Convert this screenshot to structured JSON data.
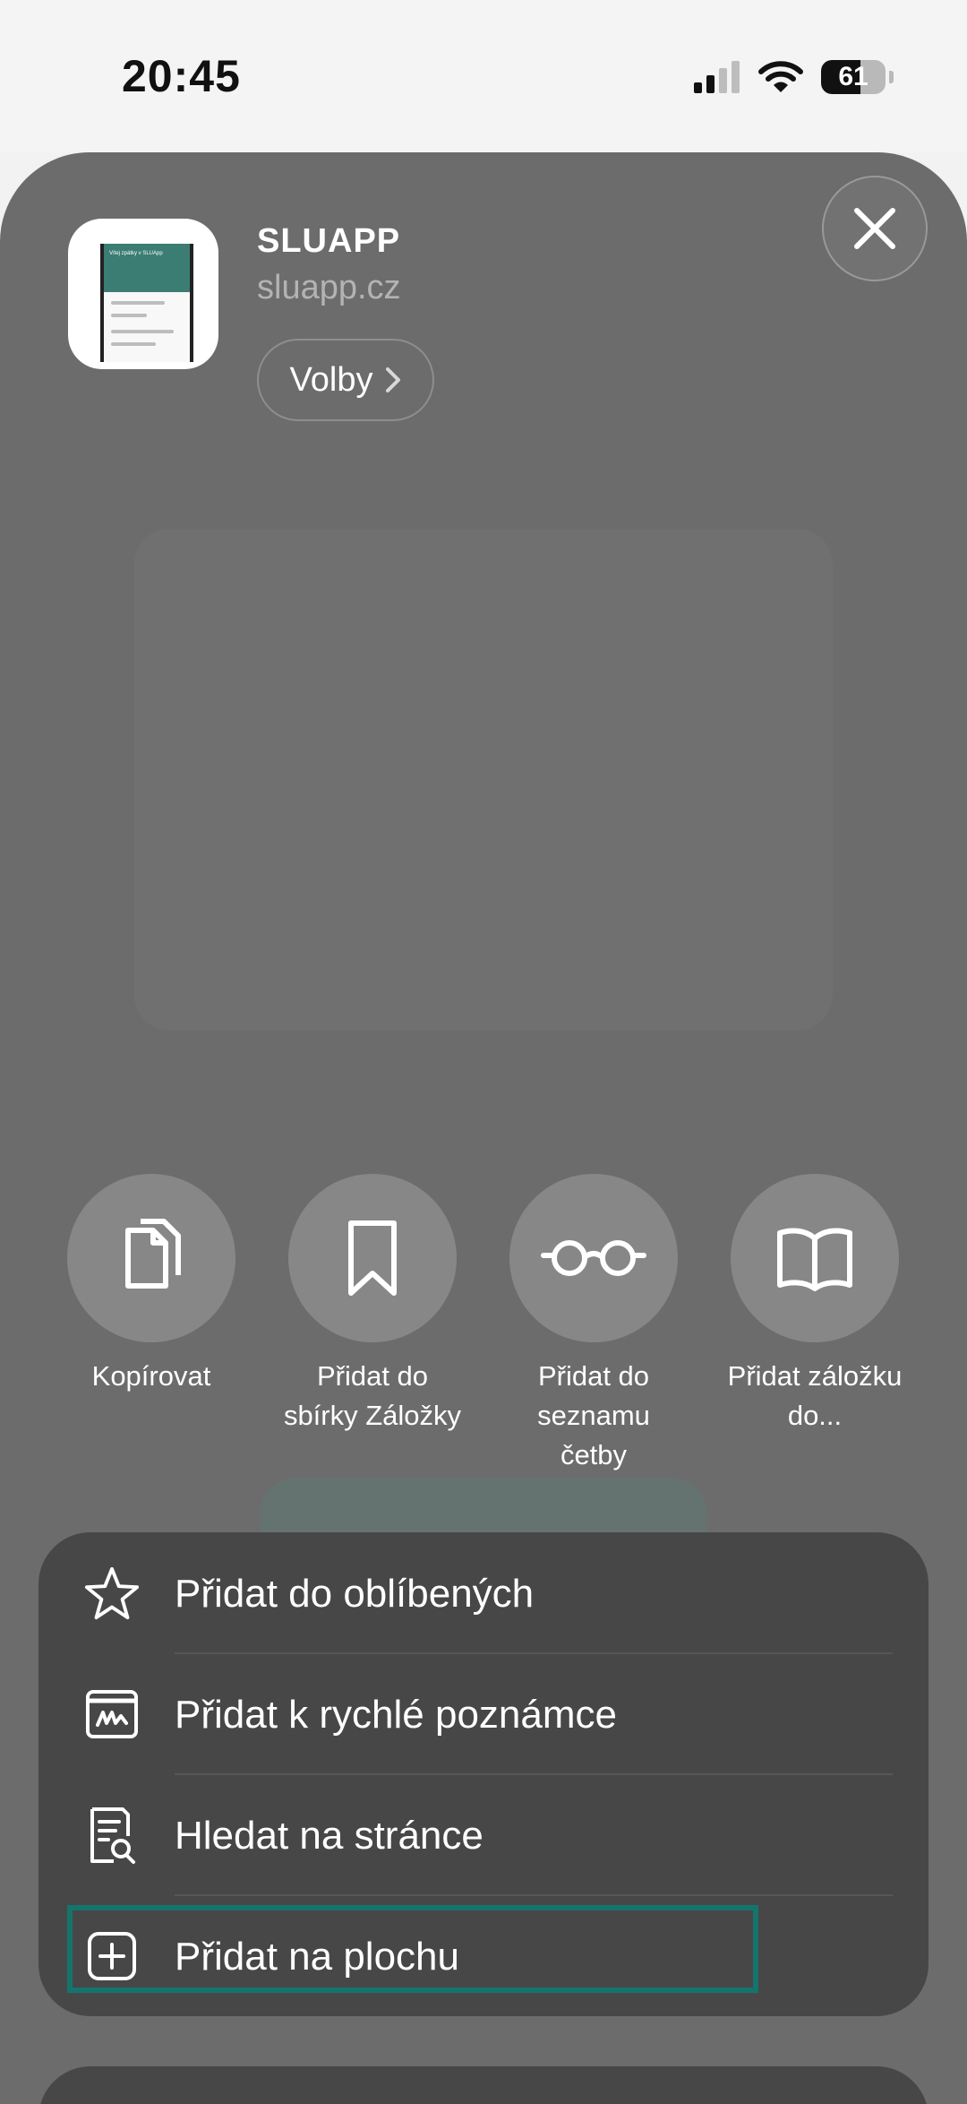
{
  "status_bar": {
    "time": "20:45",
    "battery_level": "61",
    "battery_fraction": 0.61,
    "icons": [
      "cellular-signal-icon",
      "wifi-icon",
      "battery-icon"
    ]
  },
  "share_sheet": {
    "app": {
      "title": "SLUAPP",
      "url": "sluapp.cz",
      "thumbnail_header": "Vítej zpátky v SLUApp"
    },
    "options_label": "Volby",
    "actions": [
      {
        "icon": "copy-icon",
        "label": "Kopírovat"
      },
      {
        "icon": "bookmark-icon",
        "label": "Přidat do\nsbírky Záložky"
      },
      {
        "icon": "glasses-icon",
        "label": "Přidat do\nseznamu\nčetby"
      },
      {
        "icon": "book-icon",
        "label": "Přidat záložku\ndo..."
      }
    ],
    "menu": [
      {
        "icon": "star-icon",
        "label": "Přidat do oblíbených"
      },
      {
        "icon": "quick-note-icon",
        "label": "Přidat k rychlé poznámce"
      },
      {
        "icon": "find-on-page-icon",
        "label": "Hledat na stránce"
      },
      {
        "icon": "add-square-icon",
        "label": "Přidat na plochu"
      }
    ]
  },
  "colors": {
    "sheet_background": "#6c6c6c",
    "menu_background": "#474747",
    "highlight": "#14756c",
    "action_circle": "#878787"
  }
}
